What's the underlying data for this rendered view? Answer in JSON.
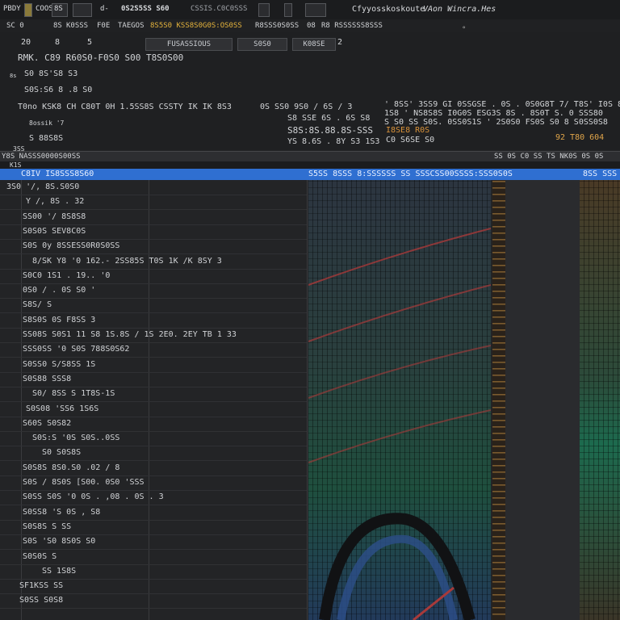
{
  "menubar": {
    "app": "PBDY",
    "field1": "COOSSE",
    "items": [
      "8S",
      "d-",
      "0S2S5SS S60",
      "CSSIS.C0C0SSS"
    ],
    "title_left": "Cfyyosskoskoute",
    "title_right": "VAon Wincra.Hes"
  },
  "toolbar": {
    "items": [
      "SC 0",
      "8S",
      "K0SSS",
      "F0E",
      "TAEGOS",
      "8S5S0 KSS8S0G0S:OS0SS",
      "R8SSS0S0SS",
      "08",
      "R8 RSSSSSS8SSS"
    ],
    "right_glyph": "°"
  },
  "header": {
    "tab_label": "20",
    "tab_num1": "8",
    "tab_num2": "5",
    "tab_buttons": [
      "FUSASSIOUS",
      "S0S0",
      "K08SE"
    ],
    "tab_right_num": "2",
    "line1": "RMK. C89  R60S0-F0S0  S00  T8S0S00",
    "row_a_prefix": "8s",
    "row_a": "S0 8S'S8 S3",
    "row_b": "S0S:S6 8 .8 S0",
    "line_main_left": "T0no  KSK8 CH  C80T 0H  1.5SS8S  CSSTY  IK  IK  8S3",
    "line_main_mid": "0S   SS0 9S0 / 6S  /  3",
    "line_main_mid2": "S8 SSE   6S . 6S S8",
    "line_main_mid3": "S8S:8S.88.8S-SSS",
    "line_main_mid4": "YS  8.6S . 8Y  S3  1S3",
    "line_main_right": "'   8SS' 3SS9  GI  0SSGSE . 0S . 0S0G8T  7/  T8S'  I0S  8S",
    "line_main_right2": "1S8 ' NS8S8S  I0G0S  ESG3S  8S  .  8S0T   S.  0  SSS80",
    "line_main_right3": "S  S0 SS S0S. 0SS0S1S  ' 2S0S0  FS0S  S0 8  S0SS0S8",
    "line_main_right4": "I8SE8 R0S",
    "line_main_right5": "C0 S6SE S0",
    "right_extra": "92  T80  604",
    "small_label": "8ossik  '7",
    "small_label2": "S  88S8S",
    "small_label3": "3SS"
  },
  "colstrip": {
    "left": "Y8S    NASSS0000S00SS",
    "right": "SS   0S   C0   SS   TS  NK0S  0S   0S"
  },
  "rowhead": {
    "label": "K1S"
  },
  "selected_row": {
    "left": "C8IV  IS8SSS8S60",
    "mid": "S5SS 8SSS 8:SSSSSS  SS  SSSCSS00SSSS:SSS0S0S",
    "right": "8SS SSS"
  },
  "list": [
    {
      "text": "3S0  '/,  8S.S0S0",
      "indent": 8
    },
    {
      "text": "Y  /,  8S . 32",
      "indent": 32
    },
    {
      "text": "SS00  '/  8S8S8",
      "indent": 28
    },
    {
      "text": "S0S0S  SEV8C0S",
      "indent": 28
    },
    {
      "text": "S0S  0y  8SSESS0R0S0SS",
      "indent": 28
    },
    {
      "text": "8/SK  Y8  '0  162.- 2SS85S  T0S  1K  /K  8SY  3",
      "indent": 40
    },
    {
      "text": "S0C0   1S1  .  19..  '0",
      "indent": 28
    },
    {
      "text": "0S0  / .  0S  S0  '",
      "indent": 28
    },
    {
      "text": "S8S/  S",
      "indent": 28
    },
    {
      "text": "S8S0S  0S  F8SS  3",
      "indent": 28
    },
    {
      "text": "SS08S  S0S1  11  S8  1S.8S  /  1S  2E0.  2EY  TB  1  33",
      "indent": 28
    },
    {
      "text": "SSS0SS  '0  S0S  788S0S62",
      "indent": 28
    },
    {
      "text": "S0SS0  S/S8SS  1S",
      "indent": 28
    },
    {
      "text": "S0S88  SSS8",
      "indent": 28
    },
    {
      "text": "S0/  8SS  S  1T8S-1S",
      "indent": 40
    },
    {
      "text": "S0S08  'SS6  1S6S",
      "indent": 32
    },
    {
      "text": "S60S  S0S82",
      "indent": 28
    },
    {
      "text": "S0S:S  '0S  S0S..0SS",
      "indent": 40
    },
    {
      "text": "S0  S0S8S",
      "indent": 52
    },
    {
      "text": "S0S8S  8S0.S0  .02  /  8",
      "indent": 28
    },
    {
      "text": "S0S  /  8S0S  [S00. 0S0  'SSS",
      "indent": 28
    },
    {
      "text": "S0SS  S0S  '0  0S  .  ,08 . 0S . 3",
      "indent": 28
    },
    {
      "text": "S0SS8  'S  0S  ,  S8",
      "indent": 28
    },
    {
      "text": "S0S8S  S  SS",
      "indent": 28
    },
    {
      "text": "S0S  'S0  8S0S  S0",
      "indent": 28
    },
    {
      "text": "S0S0S  S",
      "indent": 28
    },
    {
      "text": "SS  1S8S",
      "indent": 52
    },
    {
      "text": "SF1KSS  SS",
      "indent": 24
    },
    {
      "text": "S0SS  S0S8",
      "indent": 24
    }
  ],
  "colors": {
    "accent": "#2f6fd1",
    "bg": "#232426",
    "panel_green": "#1d6a4e",
    "panel_blue": "#223a5a",
    "orange": "#d28a3a",
    "red_line": "#a83a3a"
  }
}
